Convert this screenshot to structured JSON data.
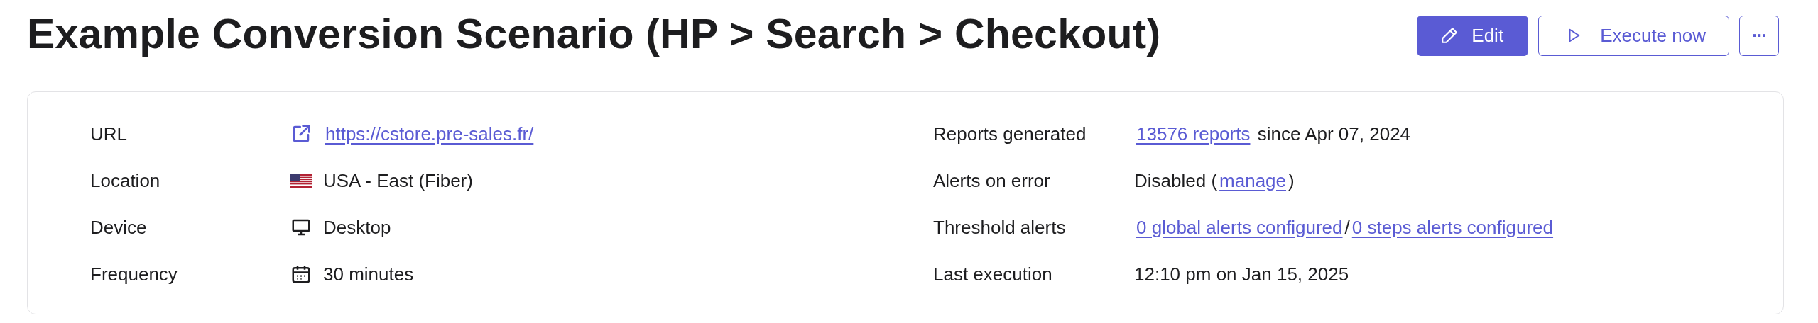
{
  "title": "Example Conversion Scenario (HP > Search > Checkout)",
  "actions": [
    {
      "kind": "edit",
      "label": "Edit"
    },
    {
      "kind": "execute",
      "label": "Execute now"
    },
    {
      "kind": "more",
      "label": "···"
    }
  ],
  "details_left": [
    {
      "label": "URL",
      "kind": "link",
      "parts": [
        {
          "kind": "link",
          "text": "https://cstore.pre-sales.fr/"
        }
      ]
    },
    {
      "label": "Location",
      "kind": "flag",
      "parts": [
        {
          "kind": "text",
          "text": "USA - East (Fiber)"
        }
      ]
    },
    {
      "label": "Device",
      "kind": "device",
      "parts": [
        {
          "kind": "text",
          "text": "Desktop"
        }
      ]
    },
    {
      "label": "Frequency",
      "kind": "schedule",
      "parts": [
        {
          "kind": "text",
          "text": "30 minutes"
        }
      ]
    }
  ],
  "details_right": [
    {
      "label": "Reports generated",
      "parts": [
        {
          "kind": "link",
          "text": "13576 reports"
        },
        {
          "kind": "text",
          "text": " since Apr 07, 2024"
        }
      ]
    },
    {
      "label": "Alerts on error",
      "parts": [
        {
          "kind": "text",
          "text": "Disabled ("
        },
        {
          "kind": "link",
          "text": "manage"
        },
        {
          "kind": "text",
          "text": ")"
        }
      ]
    },
    {
      "label": "Threshold alerts",
      "parts": [
        {
          "kind": "link",
          "text": "0 global alerts configured"
        },
        {
          "kind": "text",
          "text": "/"
        },
        {
          "kind": "link",
          "text": "0 steps alerts configured"
        }
      ]
    },
    {
      "label": "Last execution",
      "parts": [
        {
          "kind": "text",
          "text": "12:10 pm on Jan 15, 2025"
        }
      ]
    }
  ]
}
